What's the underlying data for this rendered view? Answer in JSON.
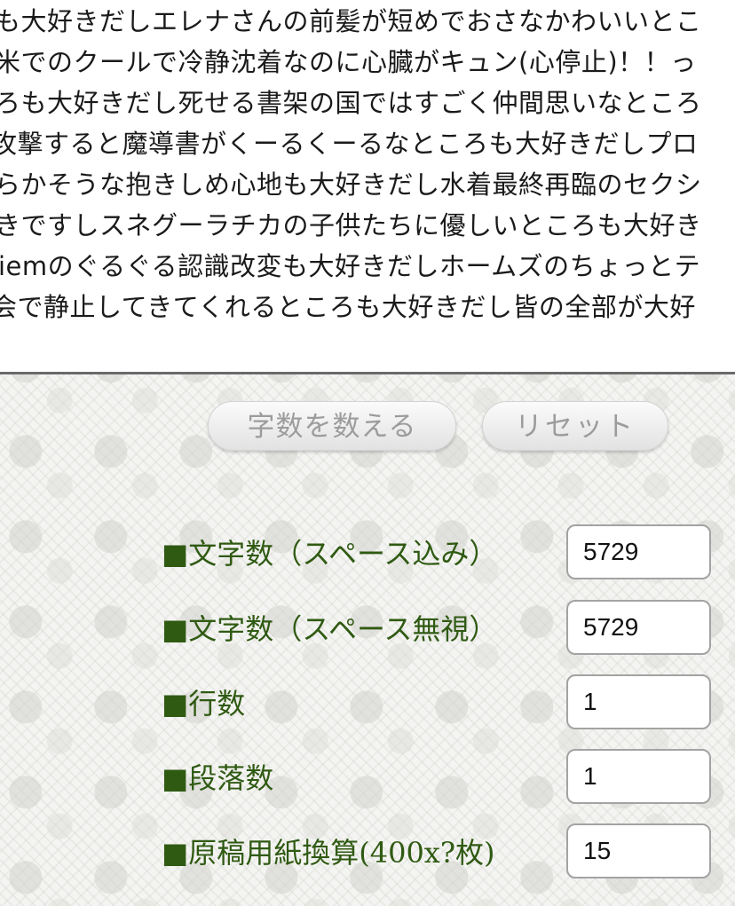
{
  "text_input": {
    "lines": [
      "も大好きだしエレナさんの前髪が短めでおさなかわいいとこ",
      "米でのクールで冷静沈着なのに心臓がキュン(心停止)！！っ",
      "ろも大好きだし死せる書架の国ではすごく仲間思いなところ",
      "攻撃すると魔導書がくーるくーるなところも大好きだしプロ",
      "らかそうな抱きしめ心地も大好きだし水着最終再臨のセクシ",
      "きですしスネグーラチカの子供たちに優しいところも大好き",
      "iemのぐるぐる認識改変も大好きだしホームズのちょっとテ",
      "会で静止してきてくれるところも大好きだし皆の全部が大好"
    ]
  },
  "buttons": {
    "count_label": "字数を数える",
    "reset_label": "リセット"
  },
  "stats": [
    {
      "label": "■文字数（スペース込み）",
      "value": "5729"
    },
    {
      "label": "■文字数（スペース無視）",
      "value": "5729"
    },
    {
      "label": "■行数",
      "value": "1"
    },
    {
      "label": "■段落数",
      "value": "1"
    },
    {
      "label": "■原稿用紙換算(400x?枚)",
      "value": "15"
    }
  ]
}
